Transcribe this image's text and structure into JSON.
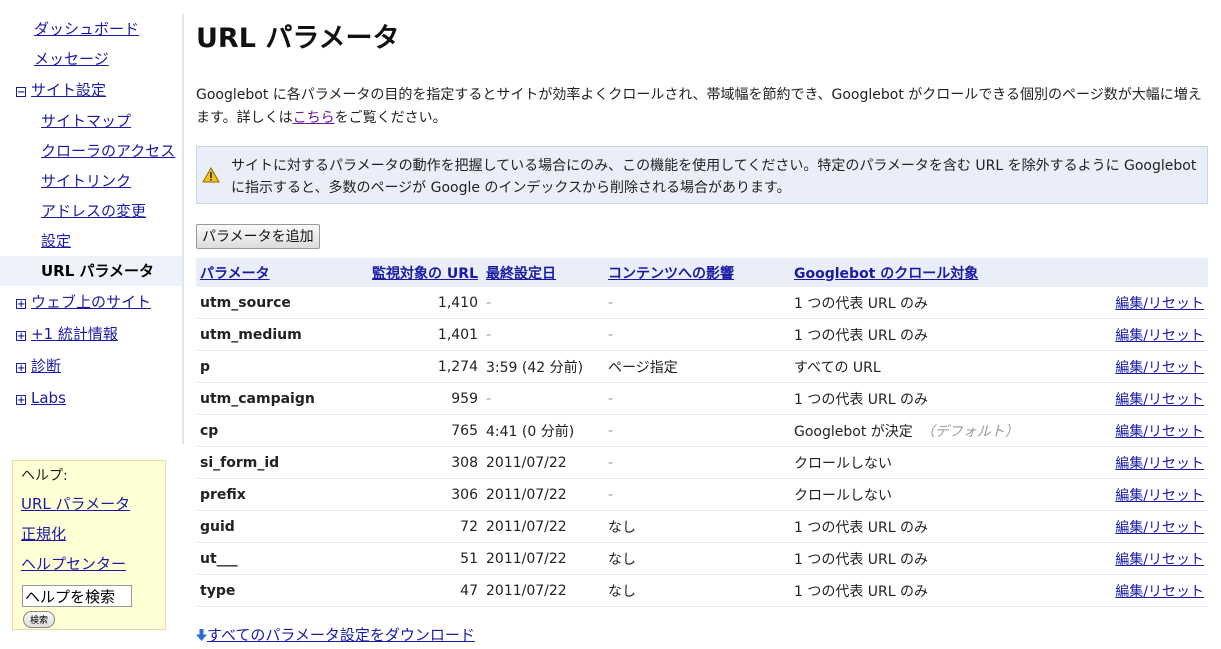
{
  "sidebar": {
    "items": [
      {
        "label": "ダッシュボード",
        "level": 0
      },
      {
        "label": "メッセージ",
        "level": 0
      },
      {
        "label": "サイト設定",
        "level": "section",
        "expanded": true
      },
      {
        "label": "サイトマップ",
        "level": 1
      },
      {
        "label": "クローラのアクセス",
        "level": 1
      },
      {
        "label": "サイトリンク",
        "level": 1
      },
      {
        "label": "アドレスの変更",
        "level": 1
      },
      {
        "label": "設定",
        "level": 1
      },
      {
        "label": "URL パラメータ",
        "level": 1,
        "active": true
      },
      {
        "label": "ウェブ上のサイト",
        "level": "section",
        "expanded": false
      },
      {
        "label": "+1 統計情報",
        "level": "section",
        "expanded": false
      },
      {
        "label": "診断",
        "level": "section",
        "expanded": false
      },
      {
        "label": "Labs",
        "level": "section",
        "expanded": false
      }
    ]
  },
  "help": {
    "title": "ヘルプ:",
    "links": [
      "URL パラメータ",
      "正規化",
      "ヘルプセンター"
    ],
    "search_value": "ヘルプを検索",
    "search_button": "検索"
  },
  "page": {
    "title": "URL パラメータ",
    "intro_before_link": "Googlebot に各パラメータの目的を指定するとサイトが効率よくクロールされ、帯域幅を節約でき、Googlebot がクロールできる個別のページ数が大幅に増えます。詳しくは",
    "intro_link": "こちら",
    "intro_after_link": "をご覧ください。",
    "warning": "サイトに対するパラメータの動作を把握している場合にのみ、この機能を使用してください。特定のパラメータを含む URL を除外するように Googlebot に指示すると、多数のページが Google のインデックスから削除される場合があります。",
    "add_button": "パラメータを追加",
    "download_link": "すべてのパラメータ設定をダウンロード"
  },
  "table": {
    "headers": {
      "param": "パラメータ",
      "urls": "監視対象の URL",
      "last": "最終設定日",
      "effect": "コンテンツへの影響",
      "crawl": "Googlebot のクロール対象"
    },
    "edit_label": "編集",
    "reset_label": "/リセット",
    "rows": [
      {
        "param": "utm_source",
        "urls": "1,410",
        "last": "-",
        "effect": "-",
        "crawl": "1 つの代表 URL のみ",
        "hint": ""
      },
      {
        "param": "utm_medium",
        "urls": "1,401",
        "last": "-",
        "effect": "-",
        "crawl": "1 つの代表 URL のみ",
        "hint": ""
      },
      {
        "param": "p",
        "urls": "1,274",
        "last": "3:59 (42 分前)",
        "effect": "ページ指定",
        "crawl": "すべての URL",
        "hint": ""
      },
      {
        "param": "utm_campaign",
        "urls": "959",
        "last": "-",
        "effect": "-",
        "crawl": "1 つの代表 URL のみ",
        "hint": ""
      },
      {
        "param": "cp",
        "urls": "765",
        "last": "4:41 (0 分前)",
        "effect": "-",
        "crawl": "Googlebot が決定",
        "hint": "（デフォルト）"
      },
      {
        "param": "si_form_id",
        "urls": "308",
        "last": "2011/07/22",
        "effect": "-",
        "crawl": "クロールしない",
        "hint": ""
      },
      {
        "param": "prefix",
        "urls": "306",
        "last": "2011/07/22",
        "effect": "-",
        "crawl": "クロールしない",
        "hint": ""
      },
      {
        "param": "guid",
        "urls": "72",
        "last": "2011/07/22",
        "effect": "なし",
        "crawl": "1 つの代表 URL のみ",
        "hint": ""
      },
      {
        "param": "ut___",
        "urls": "51",
        "last": "2011/07/22",
        "effect": "なし",
        "crawl": "1 つの代表 URL のみ",
        "hint": ""
      },
      {
        "param": "type",
        "urls": "47",
        "last": "2011/07/22",
        "effect": "なし",
        "crawl": "1 つの代表 URL のみ",
        "hint": ""
      }
    ]
  },
  "colors": {
    "link": "#1a1aa6",
    "visited": "#6a1b9a",
    "header_bg": "#e9eef8",
    "help_bg": "#ffffd6"
  },
  "icons": {
    "warning": "warning-triangle-icon",
    "download": "download-arrow-icon",
    "expand": "plus-box-icon",
    "collapse": "minus-box-icon"
  }
}
